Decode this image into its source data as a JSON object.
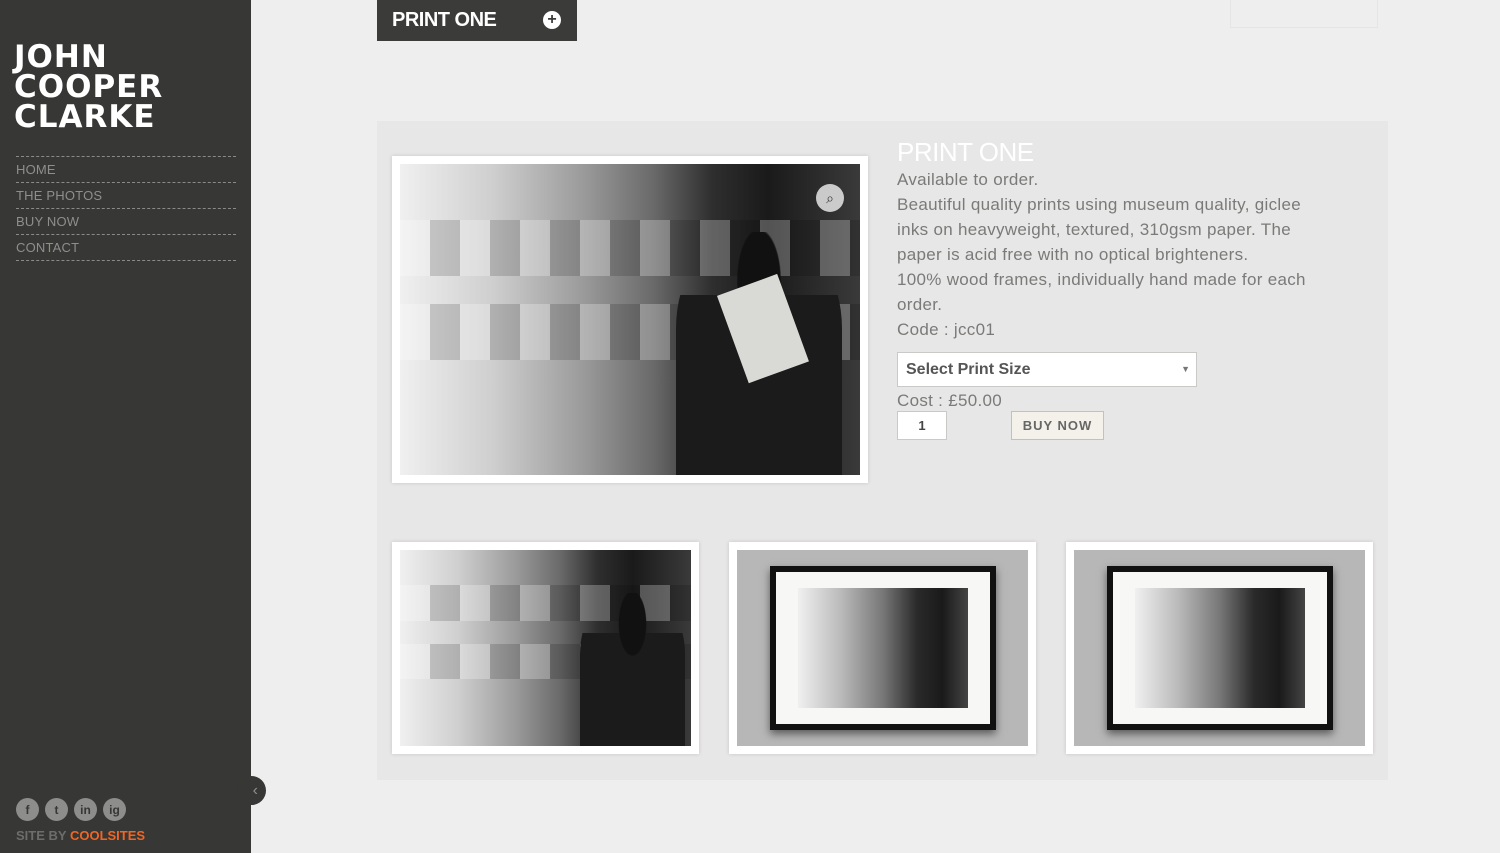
{
  "sidebar": {
    "logo": [
      "JOHN",
      "COOPER",
      "CLARKE"
    ],
    "nav": [
      "HOME",
      "THE PHOTOS",
      "BUY NOW",
      "CONTACT"
    ],
    "social": [
      "f",
      "t",
      "in",
      "ig"
    ],
    "credit_prefix": "SITE BY ",
    "credit_brand": "COOLSITES",
    "collapse_icon": "‹"
  },
  "header": {
    "tab_title": "PRINT ONE",
    "tab_icon": "+"
  },
  "product": {
    "title": "PRINT ONE",
    "lines": [
      "Available to order.",
      "Beautiful quality prints using museum quality, giclee inks on heavyweight, textured, 310gsm paper. The paper is acid free with no optical brighteners.",
      "100%  wood frames,  individually hand made for each order.",
      "Code : jcc01"
    ],
    "select_label": "Select Print Size",
    "cost": "Cost : £50.00",
    "quantity": "1",
    "buy_label": "BUY NOW"
  },
  "colors": {
    "sidebar": "#373735",
    "accent": "#f26522",
    "background": "#efeeee"
  }
}
